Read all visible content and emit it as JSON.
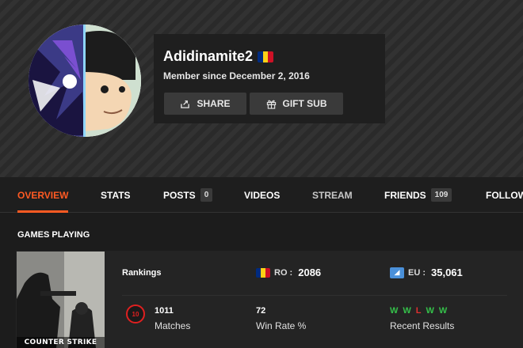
{
  "profile": {
    "username": "Adidinamite2",
    "member_since": "Member since December 2, 2016",
    "flag_colors": [
      "#002B7F",
      "#FCD116",
      "#CE1126"
    ],
    "avatar_icon": "anime-avatar-icon"
  },
  "actions": {
    "share_label": "SHARE",
    "gift_label": "GIFT SUB"
  },
  "nav": {
    "items": [
      {
        "label": "OVERVIEW"
      },
      {
        "label": "STATS"
      },
      {
        "label": "POSTS",
        "count": "0"
      },
      {
        "label": "VIDEOS"
      },
      {
        "label": "STREAM"
      },
      {
        "label": "FRIENDS",
        "count": "109"
      },
      {
        "label": "FOLLOW"
      }
    ]
  },
  "games": {
    "section_title": "GAMES PLAYING",
    "game": {
      "cover_title": "COUNTER STRIKE",
      "rankings_label": "Rankings",
      "ro_label": "RO :",
      "ro_value": "2086",
      "eu_label": "EU :",
      "eu_value": "35,061",
      "matches_badge": "10",
      "matches_value": "1011",
      "matches_label": "Matches",
      "winrate_value": "72",
      "winrate_label": "Win Rate %",
      "recent_results": [
        "W",
        "W",
        "L",
        "W",
        "W"
      ],
      "recent_label": "Recent Results"
    }
  },
  "colors": {
    "accent": "#ff5a23",
    "win": "#35c04a",
    "loss": "#e03030"
  }
}
